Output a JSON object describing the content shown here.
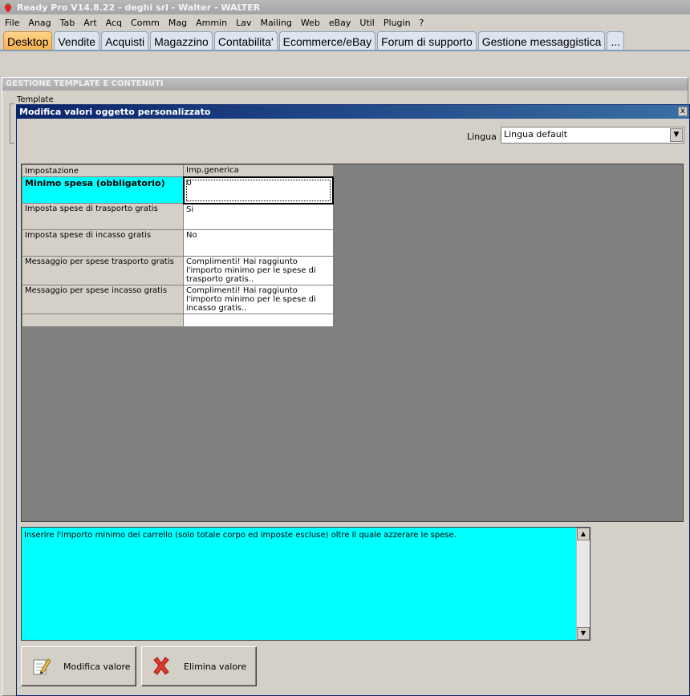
{
  "window": {
    "title": "Ready Pro V14.8.22 - deghi srl - Walter - WALTER"
  },
  "menu": [
    "File",
    "Anag",
    "Tab",
    "Art",
    "Acq",
    "Comm",
    "Mag",
    "Ammin",
    "Lav",
    "Mailing",
    "Web",
    "eBay",
    "Util",
    "Plugin",
    "?"
  ],
  "tabs": [
    {
      "label": "Desktop",
      "active": true
    },
    {
      "label": "Vendite"
    },
    {
      "label": "Acquisti"
    },
    {
      "label": "Magazzino"
    },
    {
      "label": "Contabilita'"
    },
    {
      "label": "Ecommerce/eBay"
    },
    {
      "label": "Forum di supporto"
    },
    {
      "label": "Gestione messaggistica"
    },
    {
      "label": "..."
    }
  ],
  "background_window": {
    "title": "GESTIONE TEMPLATE E CONTENUTI",
    "label": "Template"
  },
  "dialog": {
    "title": "Modifica valori oggetto personalizzato",
    "close_glyph": "x",
    "language_label": "Lingua :",
    "language_value": "Lingua default",
    "grid": {
      "columns": [
        "Impostazione",
        "Imp.generica"
      ],
      "rows": [
        {
          "setting": "Minimo spesa (obbligatorio)",
          "value": "0"
        },
        {
          "setting": "Imposta spese di trasporto gratis",
          "value": "Si"
        },
        {
          "setting": "Imposta spese di incasso gratis",
          "value": "No"
        },
        {
          "setting": "Messaggio per spese trasporto gratis",
          "value": "Complimenti! Hai raggiunto l'importo minimo per le spese di trasporto gratis.."
        },
        {
          "setting": "Messaggio per spese incasso gratis",
          "value": "Complimenti! Hai raggiunto l'importo minimo per le spese di incasso gratis.."
        },
        {
          "setting": "",
          "value": ""
        }
      ]
    },
    "description": "Inserire l'importo minimo del carrello (solo totale corpo ed imposte escluse) oltre il quale azzerare le spese.",
    "buttons": {
      "modifica": "Modifica valore",
      "elimina": "Elimina valore"
    }
  },
  "colors": {
    "selected_cell": "#00ffff",
    "dialog_title": "#0a246a",
    "active_tab": "#f6b04b"
  }
}
